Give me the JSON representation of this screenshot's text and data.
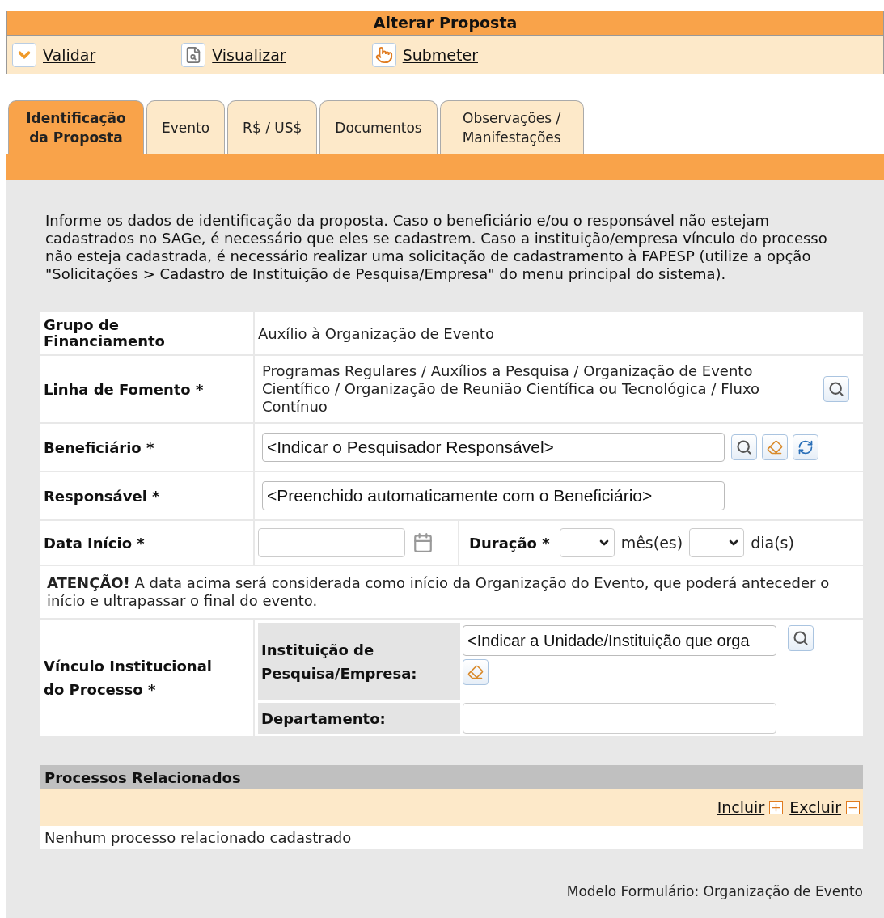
{
  "window": {
    "title": "Alterar Proposta"
  },
  "toolbar": [
    {
      "label": "Validar"
    },
    {
      "label": "Visualizar"
    },
    {
      "label": "Submeter"
    }
  ],
  "tabs": [
    {
      "label": "Identificação da Proposta",
      "selected": true
    },
    {
      "label": "Evento",
      "selected": false
    },
    {
      "label": "R$ / US$",
      "selected": false
    },
    {
      "label": "Documentos",
      "selected": false
    },
    {
      "label": "Observações / Manifestações",
      "selected": false
    }
  ],
  "intro": "Informe os dados de identificação da proposta. Caso o beneficiário e/ou o responsável não estejam cadastrados no SAGe, é necessário que eles se cadastrem. Caso a instituição/empresa vínculo do processo não esteja cadastrada, é necessário realizar uma solicitação de cadastramento à FAPESP (utilize a opção \"Solicitações > Cadastro de Instituição de Pesquisa/Empresa\" do menu principal do sistema).",
  "form": {
    "grupo": {
      "label": "Grupo de Financiamento",
      "value": "Auxílio à Organização de Evento"
    },
    "linha": {
      "label": "Linha de Fomento *",
      "value": "Programas Regulares / Auxílios a Pesquisa / Organização de Evento Científico / Organização de Reunião Científica ou Tecnológica / Fluxo Contínuo"
    },
    "beneficiario": {
      "label": "Beneficiário *",
      "value": "<Indicar o Pesquisador Responsável>"
    },
    "responsavel": {
      "label": "Responsável *",
      "value": "<Preenchido automaticamente com o Beneficiário>"
    },
    "data_inicio": {
      "label": "Data Início *"
    },
    "duracao": {
      "label": "Duração *",
      "unit_1": "mês(es)",
      "unit_2": "dia(s)"
    },
    "atencao": "**ATENÇÃO!** A data acima será considerada como início da Organização do Evento, que poderá anteceder o início e ultrapassar o final do evento.",
    "vinculo": {
      "label": "Vínculo Institucional do Processo *",
      "instituicao_label": "Instituição de Pesquisa/Empresa:",
      "instituicao_value": "<Indicar a Unidade/Instituição que orga",
      "departamento_label": "Departamento:"
    }
  },
  "processos": {
    "title": "Processos Relacionados",
    "actions": [
      "Incluir",
      "Excluir"
    ],
    "empty": "Nenhum processo relacionado cadastrado"
  },
  "footer": "Modelo Formulário: Organização de Evento"
}
